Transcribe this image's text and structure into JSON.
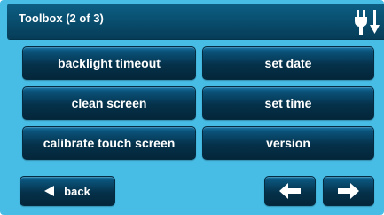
{
  "header": {
    "title": "Toolbox (2 of 3)",
    "status_icon": "power-plug-icon"
  },
  "menu": {
    "left": [
      {
        "label": "backlight timeout"
      },
      {
        "label": "clean screen"
      },
      {
        "label": "calibrate touch screen"
      }
    ],
    "right": [
      {
        "label": "set date"
      },
      {
        "label": "set time"
      },
      {
        "label": "version"
      }
    ]
  },
  "footer": {
    "back_label": "back",
    "back_icon": "triangle-left-icon",
    "prev_icon": "arrow-left-icon",
    "next_icon": "arrow-right-icon"
  },
  "colors": {
    "background": "#47bde6",
    "header": "#063c57",
    "button": "#05314a",
    "text": "#ffffff"
  }
}
